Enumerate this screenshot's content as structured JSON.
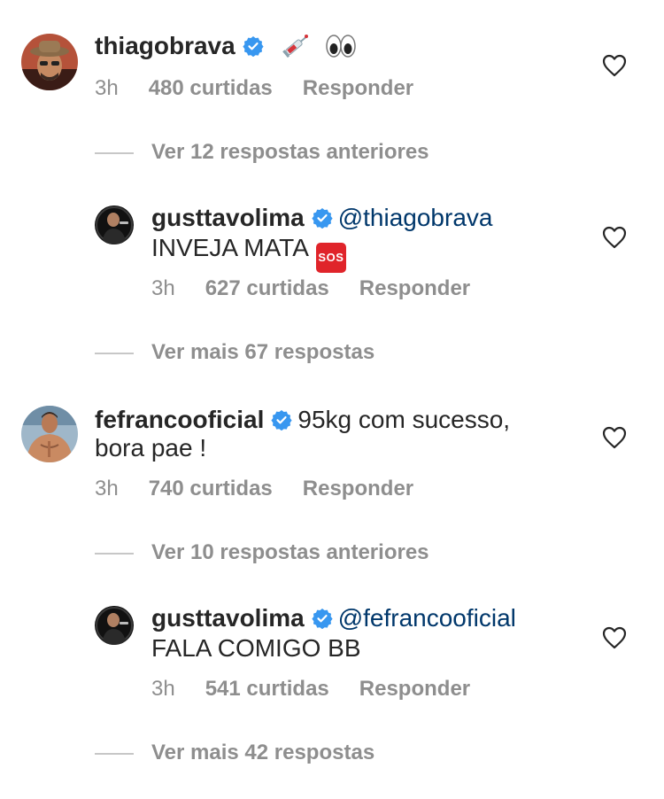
{
  "comments": [
    {
      "username": "thiagobrava",
      "text_tail": "",
      "time": "3h",
      "likes": "480 curtidas",
      "reply": "Responder",
      "thread_link": "Ver 12 respostas anteriores"
    },
    {
      "username": "fefrancooficial",
      "text_line1": "95kg com sucesso,",
      "text_line2": "bora pae !",
      "time": "3h",
      "likes": "740 curtidas",
      "reply": "Responder",
      "thread_link": "Ver 10 respostas anteriores"
    }
  ],
  "replies": [
    {
      "username": "gusttavolima",
      "mention": "@thiagobrava",
      "text": "INVEJA MATA",
      "sos_label": "SOS",
      "time": "3h",
      "likes": "627 curtidas",
      "reply": "Responder",
      "more_link": "Ver mais 67 respostas"
    },
    {
      "username": "gusttavolima",
      "mention": "@fefrancooficial",
      "text": "FALA COMIGO BB",
      "time": "3h",
      "likes": "541 curtidas",
      "reply": "Responder",
      "more_link": "Ver mais 42 respostas"
    }
  ],
  "colors": {
    "verified": "#3897f0",
    "meta": "#8e8e8e",
    "mention": "#00376b",
    "sos": "#e0242a"
  },
  "icons": [
    "verified-badge-icon",
    "syringe-icon",
    "eyes-icon",
    "sos-icon",
    "heart-icon"
  ]
}
